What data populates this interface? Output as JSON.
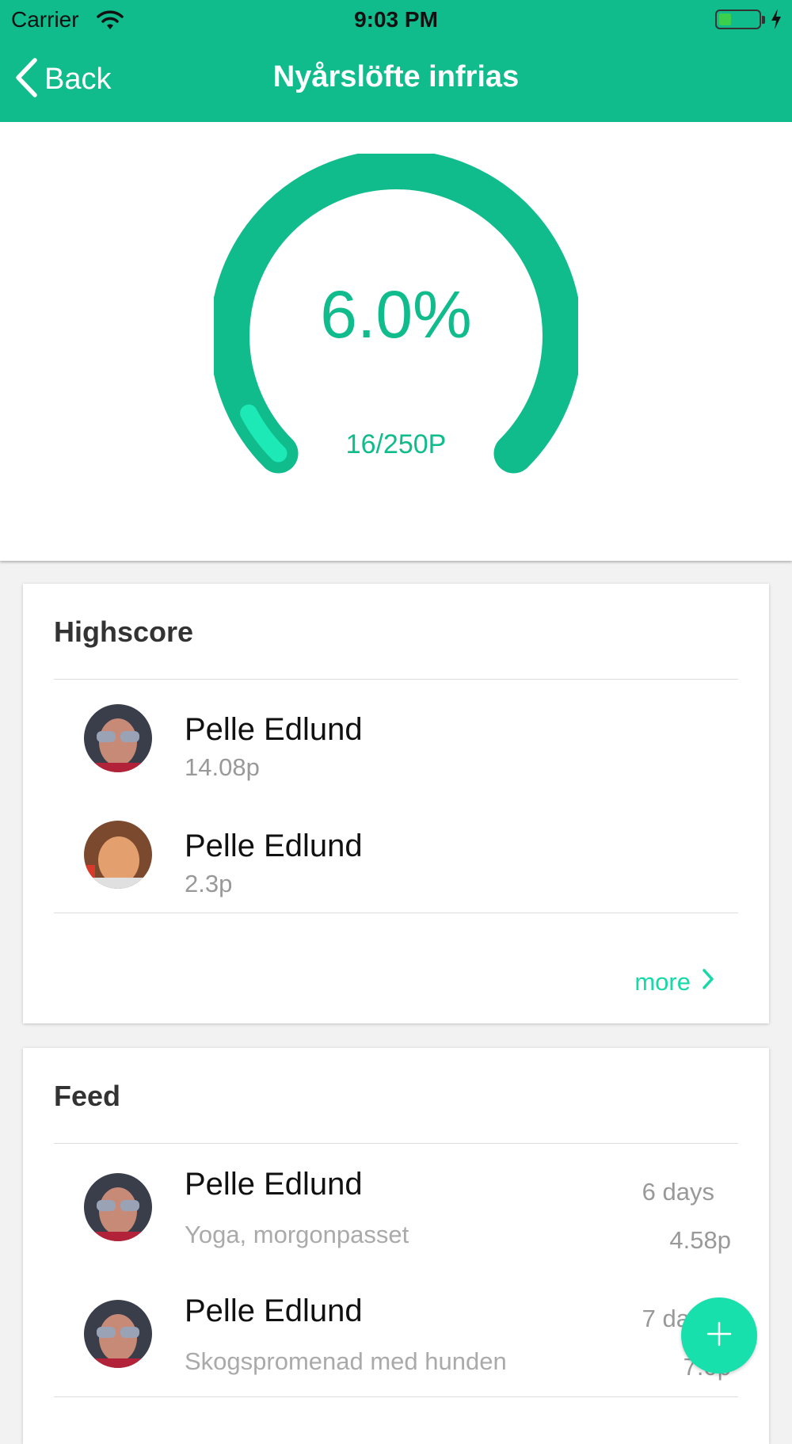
{
  "status_bar": {
    "carrier": "Carrier",
    "time": "9:03 PM",
    "battery_level": 0.25
  },
  "nav": {
    "back_label": "Back",
    "title": "Nyårslöfte infrias"
  },
  "progress": {
    "percent_label": "6.0%",
    "points_label": "16/250P",
    "fraction": 0.064
  },
  "highscore": {
    "title": "Highscore",
    "more_label": "more",
    "entries": [
      {
        "name": "Pelle Edlund",
        "score": "14.08p"
      },
      {
        "name": "Pelle Edlund",
        "score": "2.3p"
      }
    ]
  },
  "feed": {
    "title": "Feed",
    "entries": [
      {
        "name": "Pelle Edlund",
        "activity": "Yoga, morgonpasset",
        "time": "6 days",
        "points": "4.58p"
      },
      {
        "name": "Pelle Edlund",
        "activity": "Skogspromenad med hunden",
        "time": "7 days",
        "points": "7.0p"
      }
    ]
  },
  "colors": {
    "brand": "#10bb8c",
    "accent": "#17e0ad",
    "progress_highlight": "#1de9b6"
  },
  "icons": {
    "back": "chevron-left-icon",
    "more": "chevron-right-icon",
    "fab": "plus-icon"
  }
}
